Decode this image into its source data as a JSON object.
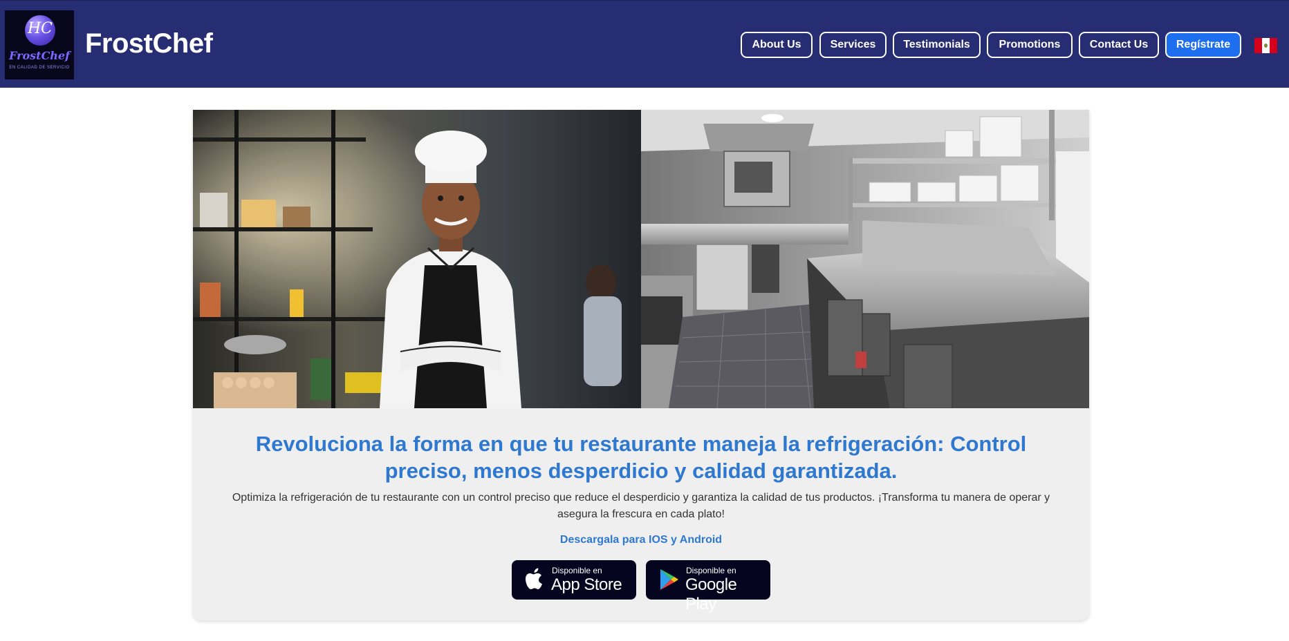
{
  "header": {
    "logo": {
      "monogram": "HC",
      "name": "FrostChef",
      "tagline": "EN CALIDAD DE SERVICIO"
    },
    "brand": "FrostChef",
    "nav": [
      "About Us",
      "Services",
      "Testimonials",
      "Promotions",
      "Contact Us"
    ],
    "register_label": "Regístrate",
    "flag_icon": "peru-flag-icon",
    "colors": {
      "header_bg": "#262d72",
      "accent": "#1d6ff0"
    }
  },
  "hero": {
    "images": [
      "chef-photo",
      "kitchen-photo"
    ],
    "headline": "Revoluciona la forma en que tu restaurante maneja la refrigeración: Control preciso, menos desperdicio y calidad garantizada.",
    "subtext": "Optimiza la refrigeración de tu restaurante con un control preciso que reduce el desperdicio y garantiza la calidad de tus productos. ¡Transforma tu manera de operar y asegura la frescura en cada plato!",
    "download_label": "Descargala para IOS y Android",
    "stores": [
      {
        "small": "Disponible en",
        "big": "App Store",
        "icon": "apple-icon"
      },
      {
        "small": "Disponible en",
        "big": "Google Play",
        "icon": "google-play-icon"
      }
    ],
    "colors": {
      "headline": "#2f78d0",
      "card_bg": "#efefef"
    }
  }
}
